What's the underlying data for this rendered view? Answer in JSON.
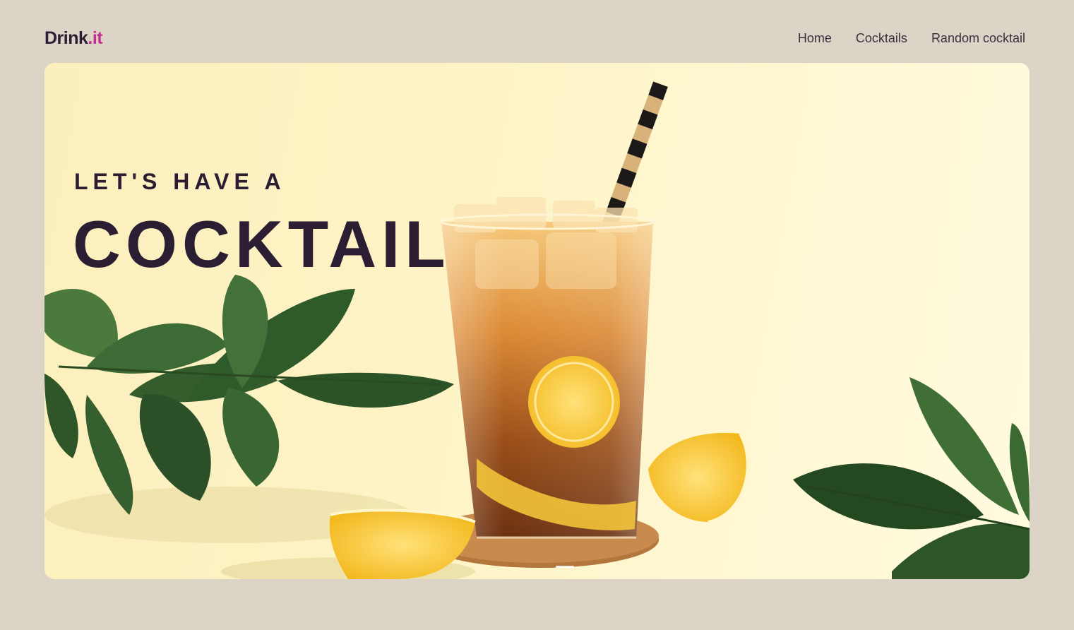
{
  "brand": {
    "name": "Drink",
    "suffix": ".it",
    "accent_color": "#c42d8f"
  },
  "nav": {
    "items": [
      {
        "label": "Home"
      },
      {
        "label": "Cocktails"
      },
      {
        "label": "Random cocktail"
      }
    ]
  },
  "hero": {
    "tagline": "LET'S HAVE A",
    "headline": "COCKTAIL",
    "image": "iced-tea-cocktail-with-lemon-and-leaves"
  },
  "colors": {
    "page_background": "#dcd4c6",
    "text_dark": "#2b1e33",
    "hero_background": "#fdf3c5"
  }
}
